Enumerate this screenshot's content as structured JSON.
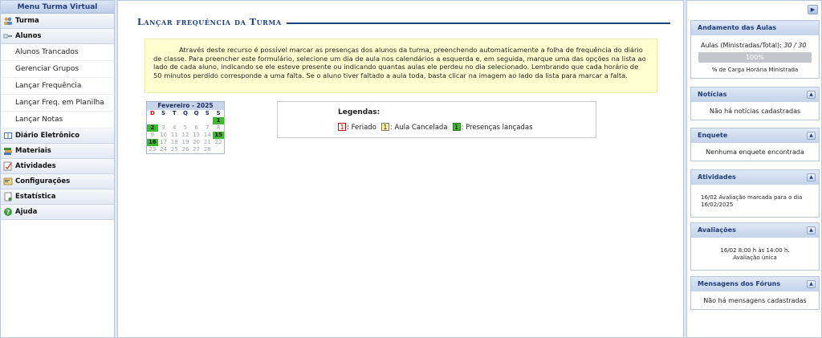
{
  "left_menu": {
    "title": "Menu Turma Virtual",
    "sections": [
      {
        "label": "Turma",
        "icon": "group-icon"
      },
      {
        "label": "Alunos",
        "icon": "student-icon",
        "items": [
          "Alunos Trancados",
          "Gerenciar Grupos",
          "Lançar Frequência",
          "Lançar Freq. em Planilha",
          "Lançar Notas"
        ]
      },
      {
        "label": "Diário Eletrônico",
        "icon": "book-icon"
      },
      {
        "label": "Materiais",
        "icon": "materials-icon"
      },
      {
        "label": "Atividades",
        "icon": "activity-icon"
      },
      {
        "label": "Configurações",
        "icon": "config-icon"
      },
      {
        "label": "Estatística",
        "icon": "statistics-icon"
      },
      {
        "label": "Ajuda",
        "icon": "help-icon"
      }
    ]
  },
  "main": {
    "title": "Lançar frequência da Turma",
    "description": "Através deste recurso é possível marcar as presenças dos alunos da turma, preenchendo automaticamente a folha de frequência do diário de classe. Para preencher este formulário, selecione um dia de aula nos calendários a esquerda e, em seguida, marque uma das opções na lista ao lado de cada aluno, indicando se ele esteve presente ou indicando quantas aulas ele perdeu no dia selecionado. Lembrando que cada horário de 50 minutos perdido corresponde a uma falta. Se o aluno tiver faltado a aula toda, basta clicar na imagem ao lado da lista para marcar a falta.",
    "calendar": {
      "month": "Fevereiro - 2025",
      "weekdays": [
        "D",
        "S",
        "T",
        "Q",
        "Q",
        "S",
        "S"
      ],
      "weeks": [
        [
          "",
          "",
          "",
          "",
          "",
          "",
          "1"
        ],
        [
          "2",
          "3",
          "4",
          "5",
          "6",
          "7",
          "8"
        ],
        [
          "9",
          "10",
          "11",
          "12",
          "13",
          "14",
          "15"
        ],
        [
          "16",
          "17",
          "18",
          "19",
          "20",
          "21",
          "22"
        ],
        [
          "23",
          "24",
          "25",
          "26",
          "27",
          "28",
          ""
        ]
      ],
      "highlighted_days": [
        "1",
        "2",
        "15",
        "16"
      ],
      "highlight_color": "#3dbb2c"
    },
    "legend": {
      "title": "Legendas:",
      "items": [
        {
          "box": "1",
          "label": ": Feriado",
          "style": "red"
        },
        {
          "box": "1",
          "label": ": Aula Cancelada",
          "style": "yellow"
        },
        {
          "box": "1",
          "label": ": Presenças lançadas",
          "style": "green"
        }
      ]
    }
  },
  "right": {
    "toggle_icon": "arrow-right-icon",
    "panels": {
      "andamento": {
        "title": "Andamento das Aulas",
        "label": "Aulas (Ministradas/Total):",
        "value": "30 / 30",
        "progress_percent": 100,
        "progress_text": "100%",
        "caption": "% de Carga Horária Ministrada"
      },
      "noticias": {
        "title": "Notícias",
        "text": "Não há notícias cadastradas"
      },
      "enquete": {
        "title": "Enquete",
        "text": "Nenhuma enquete encontrada"
      },
      "atividades": {
        "title": "Atividades",
        "date": "16/02",
        "text": "Avaliação marcada para o dia 16/02/2025"
      },
      "avaliacoes": {
        "title": "Avaliações",
        "line1": "16/02 8:00 h às 14:00 h.",
        "line2": "Avaliação única"
      },
      "foruns": {
        "title": "Mensagens dos Fóruns",
        "text": "Não há mensagens cadastradas"
      }
    }
  }
}
